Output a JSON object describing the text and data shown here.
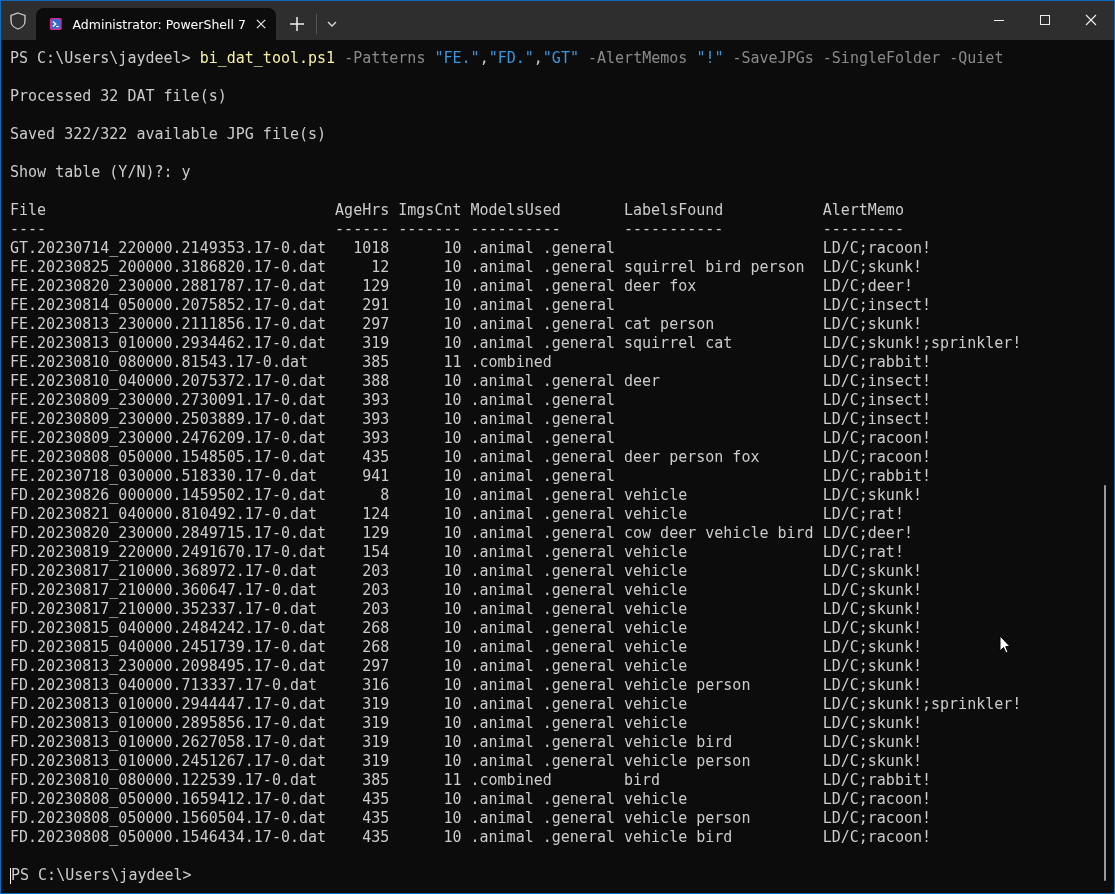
{
  "window": {
    "tab": {
      "title": "Administrator: PowerShell 7",
      "selected": true
    }
  },
  "terminal": {
    "command": {
      "prompt": "PS C:\\Users\\jaydeel> ",
      "tokens": [
        {
          "kind": "command",
          "text": "bi_dat_tool.ps1"
        },
        {
          "kind": "parameter",
          "text": " -Patterns "
        },
        {
          "kind": "string",
          "text": "\"FE.\""
        },
        {
          "kind": "operator",
          "text": ","
        },
        {
          "kind": "string",
          "text": "\"FD.\""
        },
        {
          "kind": "operator",
          "text": ","
        },
        {
          "kind": "string",
          "text": "\"GT\""
        },
        {
          "kind": "parameter",
          "text": " -AlertMemos "
        },
        {
          "kind": "string",
          "text": "\"!\""
        },
        {
          "kind": "parameter",
          "text": " -SaveJPGs -SingleFolder -Quiet"
        }
      ]
    },
    "messages": [
      "Processed 32 DAT file(s)",
      "Saved 322/322 available JPG file(s)",
      "Show table (Y/N)?: y"
    ],
    "table": {
      "columns": [
        {
          "title": "File",
          "rule": "----"
        },
        {
          "title": "AgeHrs",
          "rule": "------"
        },
        {
          "title": "ImgsCnt",
          "rule": "-------"
        },
        {
          "title": "ModelsUsed",
          "rule": "----------"
        },
        {
          "title": "LabelsFound",
          "rule": "-----------"
        },
        {
          "title": "AlertMemo",
          "rule": "---------"
        }
      ],
      "rows": [
        {
          "file": "GT.20230714_220000.2149353.17-0.dat",
          "age_hrs": "1018",
          "imgs_cnt": "10",
          "models_used": ".animal .general",
          "alert_memo": "LD/C;racoon!"
        },
        {
          "file": "FE.20230825_200000.3186820.17-0.dat",
          "age_hrs": "12",
          "imgs_cnt": "10",
          "models_used": ".animal .general",
          "labels_found": "squirrel bird person",
          "alert_memo": "LD/C;skunk!"
        },
        {
          "file": "FE.20230820_230000.2881787.17-0.dat",
          "age_hrs": "129",
          "imgs_cnt": "10",
          "models_used": ".animal .general",
          "labels_found": "deer fox",
          "alert_memo": "LD/C;deer!"
        },
        {
          "file": "FE.20230814_050000.2075852.17-0.dat",
          "age_hrs": "291",
          "imgs_cnt": "10",
          "models_used": ".animal .general",
          "alert_memo": "LD/C;insect!"
        },
        {
          "file": "FE.20230813_230000.2111856.17-0.dat",
          "age_hrs": "297",
          "imgs_cnt": "10",
          "models_used": ".animal .general",
          "labels_found": "cat person",
          "alert_memo": "LD/C;skunk!"
        },
        {
          "file": "FE.20230813_010000.2934462.17-0.dat",
          "age_hrs": "319",
          "imgs_cnt": "10",
          "models_used": ".animal .general",
          "labels_found": "squirrel cat",
          "alert_memo": "LD/C;skunk!;sprinkler!"
        },
        {
          "file": "FE.20230810_080000.81543.17-0.dat",
          "age_hrs": "385",
          "imgs_cnt": "11",
          "models_used": ".combined",
          "alert_memo": "LD/C;rabbit!"
        },
        {
          "file": "FE.20230810_040000.2075372.17-0.dat",
          "age_hrs": "388",
          "imgs_cnt": "10",
          "models_used": ".animal .general",
          "labels_found": "deer",
          "alert_memo": "LD/C;insect!"
        },
        {
          "file": "FE.20230809_230000.2730091.17-0.dat",
          "age_hrs": "393",
          "imgs_cnt": "10",
          "models_used": ".animal .general",
          "alert_memo": "LD/C;insect!"
        },
        {
          "file": "FE.20230809_230000.2503889.17-0.dat",
          "age_hrs": "393",
          "imgs_cnt": "10",
          "models_used": ".animal .general",
          "alert_memo": "LD/C;insect!"
        },
        {
          "file": "FE.20230809_230000.2476209.17-0.dat",
          "age_hrs": "393",
          "imgs_cnt": "10",
          "models_used": ".animal .general",
          "alert_memo": "LD/C;racoon!"
        },
        {
          "file": "FE.20230808_050000.1548505.17-0.dat",
          "age_hrs": "435",
          "imgs_cnt": "10",
          "models_used": ".animal .general",
          "labels_found": "deer person fox",
          "alert_memo": "LD/C;racoon!"
        },
        {
          "file": "FE.20230718_030000.518330.17-0.dat",
          "age_hrs": "941",
          "imgs_cnt": "10",
          "models_used": ".animal .general",
          "alert_memo": "LD/C;rabbit!"
        },
        {
          "file": "FD.20230826_000000.1459502.17-0.dat",
          "age_hrs": "8",
          "imgs_cnt": "10",
          "models_used": ".animal .general",
          "labels_found": "vehicle",
          "alert_memo": "LD/C;skunk!"
        },
        {
          "file": "FD.20230821_040000.810492.17-0.dat",
          "age_hrs": "124",
          "imgs_cnt": "10",
          "models_used": ".animal .general",
          "labels_found": "vehicle",
          "alert_memo": "LD/C;rat!"
        },
        {
          "file": "FD.20230820_230000.2849715.17-0.dat",
          "age_hrs": "129",
          "imgs_cnt": "10",
          "models_used": ".animal .general",
          "labels_found": "cow deer vehicle bird",
          "alert_memo": "LD/C;deer!"
        },
        {
          "file": "FD.20230819_220000.2491670.17-0.dat",
          "age_hrs": "154",
          "imgs_cnt": "10",
          "models_used": ".animal .general",
          "labels_found": "vehicle",
          "alert_memo": "LD/C;rat!"
        },
        {
          "file": "FD.20230817_210000.368972.17-0.dat",
          "age_hrs": "203",
          "imgs_cnt": "10",
          "models_used": ".animal .general",
          "labels_found": "vehicle",
          "alert_memo": "LD/C;skunk!"
        },
        {
          "file": "FD.20230817_210000.360647.17-0.dat",
          "age_hrs": "203",
          "imgs_cnt": "10",
          "models_used": ".animal .general",
          "labels_found": "vehicle",
          "alert_memo": "LD/C;skunk!"
        },
        {
          "file": "FD.20230817_210000.352337.17-0.dat",
          "age_hrs": "203",
          "imgs_cnt": "10",
          "models_used": ".animal .general",
          "labels_found": "vehicle",
          "alert_memo": "LD/C;skunk!"
        },
        {
          "file": "FD.20230815_040000.2484242.17-0.dat",
          "age_hrs": "268",
          "imgs_cnt": "10",
          "models_used": ".animal .general",
          "labels_found": "vehicle",
          "alert_memo": "LD/C;skunk!"
        },
        {
          "file": "FD.20230815_040000.2451739.17-0.dat",
          "age_hrs": "268",
          "imgs_cnt": "10",
          "models_used": ".animal .general",
          "labels_found": "vehicle",
          "alert_memo": "LD/C;skunk!"
        },
        {
          "file": "FD.20230813_230000.2098495.17-0.dat",
          "age_hrs": "297",
          "imgs_cnt": "10",
          "models_used": ".animal .general",
          "labels_found": "vehicle",
          "alert_memo": "LD/C;skunk!"
        },
        {
          "file": "FD.20230813_040000.713337.17-0.dat",
          "age_hrs": "316",
          "imgs_cnt": "10",
          "models_used": ".animal .general",
          "labels_found": "vehicle person",
          "alert_memo": "LD/C;skunk!"
        },
        {
          "file": "FD.20230813_010000.2944447.17-0.dat",
          "age_hrs": "319",
          "imgs_cnt": "10",
          "models_used": ".animal .general",
          "labels_found": "vehicle",
          "alert_memo": "LD/C;skunk!;sprinkler!"
        },
        {
          "file": "FD.20230813_010000.2895856.17-0.dat",
          "age_hrs": "319",
          "imgs_cnt": "10",
          "models_used": ".animal .general",
          "labels_found": "vehicle",
          "alert_memo": "LD/C;skunk!"
        },
        {
          "file": "FD.20230813_010000.2627058.17-0.dat",
          "age_hrs": "319",
          "imgs_cnt": "10",
          "models_used": ".animal .general",
          "labels_found": "vehicle bird",
          "alert_memo": "LD/C;skunk!"
        },
        {
          "file": "FD.20230813_010000.2451267.17-0.dat",
          "age_hrs": "319",
          "imgs_cnt": "10",
          "models_used": ".animal .general",
          "labels_found": "vehicle person",
          "alert_memo": "LD/C;skunk!"
        },
        {
          "file": "FD.20230810_080000.122539.17-0.dat",
          "age_hrs": "385",
          "imgs_cnt": "11",
          "models_used": ".combined",
          "labels_found": "bird",
          "alert_memo": "LD/C;rabbit!"
        },
        {
          "file": "FD.20230808_050000.1659412.17-0.dat",
          "age_hrs": "435",
          "imgs_cnt": "10",
          "models_used": ".animal .general",
          "labels_found": "vehicle",
          "alert_memo": "LD/C;racoon!"
        },
        {
          "file": "FD.20230808_050000.1560504.17-0.dat",
          "age_hrs": "435",
          "imgs_cnt": "10",
          "models_used": ".animal .general",
          "labels_found": "vehicle person",
          "alert_memo": "LD/C;racoon!"
        },
        {
          "file": "FD.20230808_050000.1546434.17-0.dat",
          "age_hrs": "435",
          "imgs_cnt": "10",
          "models_used": ".animal .general",
          "labels_found": "vehicle bird",
          "alert_memo": "LD/C;racoon!"
        }
      ]
    },
    "final_prompt": "PS C:\\Users\\jaydeel>"
  }
}
